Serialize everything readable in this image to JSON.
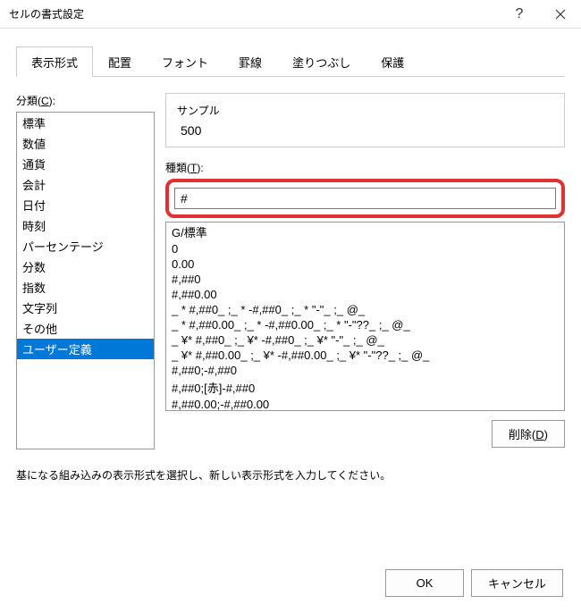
{
  "title": "セルの書式設定",
  "tabs": [
    {
      "label": "表示形式",
      "active": true
    },
    {
      "label": "配置",
      "active": false
    },
    {
      "label": "フォント",
      "active": false
    },
    {
      "label": "罫線",
      "active": false
    },
    {
      "label": "塗りつぶし",
      "active": false
    },
    {
      "label": "保護",
      "active": false
    }
  ],
  "category": {
    "label_prefix": "分類(",
    "label_key": "C",
    "label_suffix": "):",
    "items": [
      "標準",
      "数値",
      "通貨",
      "会計",
      "日付",
      "時刻",
      "パーセンテージ",
      "分数",
      "指数",
      "文字列",
      "その他",
      "ユーザー定義"
    ],
    "selected_index": 11
  },
  "sample": {
    "label": "サンプル",
    "value": "500"
  },
  "type": {
    "label_prefix": "種類(",
    "label_key": "T",
    "label_suffix": "):",
    "value": "#"
  },
  "formats": [
    "G/標準",
    "0",
    "0.00",
    "#,##0",
    "#,##0.00",
    "_ * #,##0_ ;_ * -#,##0_ ;_ * \"-\"_ ;_ @_ ",
    "_ * #,##0.00_ ;_ * -#,##0.00_ ;_ * \"-\"??_ ;_ @_ ",
    "_ ¥* #,##0_ ;_ ¥* -#,##0_ ;_ ¥* \"-\"_ ;_ @_ ",
    "_ ¥* #,##0.00_ ;_ ¥* -#,##0.00_ ;_ ¥* \"-\"??_ ;_ @_ ",
    "#,##0;-#,##0",
    "#,##0;[赤]-#,##0",
    "#,##0.00;-#,##0.00"
  ],
  "delete": {
    "label_prefix": "削除(",
    "label_key": "D",
    "label_suffix": ")"
  },
  "hint": "基になる組み込みの表示形式を選択し、新しい表示形式を入力してください。",
  "buttons": {
    "ok": "OK",
    "cancel": "キャンセル"
  }
}
